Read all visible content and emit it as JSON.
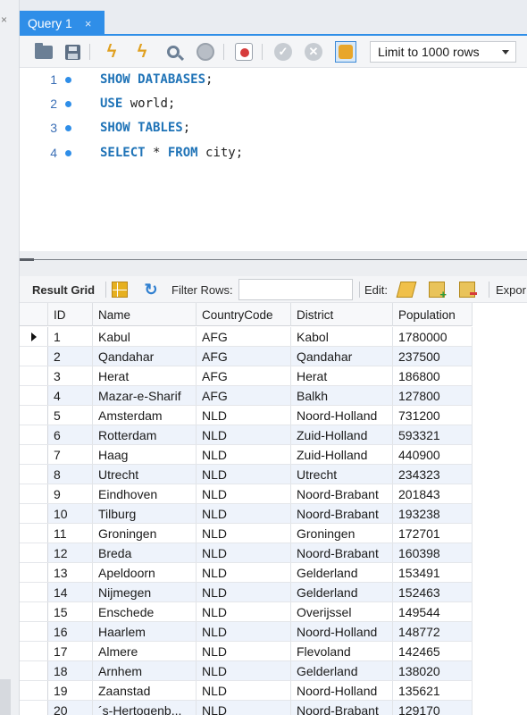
{
  "tabs": [
    {
      "label": "Query 1",
      "close": "×"
    }
  ],
  "left_strip": {
    "close": "×"
  },
  "toolbar": {
    "limit_label": "Limit to 1000 rows",
    "icons": [
      "open-folder-icon",
      "save-icon",
      "execute-icon",
      "execute-current-icon",
      "explain-icon",
      "stop-icon",
      "stop-on-error-icon",
      "commit-icon",
      "rollback-icon",
      "autocommit-icon"
    ]
  },
  "editor": {
    "lines": [
      {
        "num": "1",
        "kw": "SHOW DATABASES",
        "rest": ";"
      },
      {
        "num": "2",
        "kw": "USE",
        "rest": " world;"
      },
      {
        "num": "3",
        "kw": "SHOW TABLES",
        "rest": ";"
      },
      {
        "num": "4",
        "kw": "SELECT",
        "mid": " * ",
        "kw2": "FROM",
        "rest": " city;"
      }
    ]
  },
  "result_toolbar": {
    "result_grid": "Result Grid",
    "filter_rows": "Filter Rows:",
    "filter_value": "",
    "edit": "Edit:",
    "export": "Expor"
  },
  "grid": {
    "columns": [
      "ID",
      "Name",
      "CountryCode",
      "District",
      "Population"
    ],
    "rows": [
      [
        "1",
        "Kabul",
        "AFG",
        "Kabol",
        "1780000"
      ],
      [
        "2",
        "Qandahar",
        "AFG",
        "Qandahar",
        "237500"
      ],
      [
        "3",
        "Herat",
        "AFG",
        "Herat",
        "186800"
      ],
      [
        "4",
        "Mazar-e-Sharif",
        "AFG",
        "Balkh",
        "127800"
      ],
      [
        "5",
        "Amsterdam",
        "NLD",
        "Noord-Holland",
        "731200"
      ],
      [
        "6",
        "Rotterdam",
        "NLD",
        "Zuid-Holland",
        "593321"
      ],
      [
        "7",
        "Haag",
        "NLD",
        "Zuid-Holland",
        "440900"
      ],
      [
        "8",
        "Utrecht",
        "NLD",
        "Utrecht",
        "234323"
      ],
      [
        "9",
        "Eindhoven",
        "NLD",
        "Noord-Brabant",
        "201843"
      ],
      [
        "10",
        "Tilburg",
        "NLD",
        "Noord-Brabant",
        "193238"
      ],
      [
        "11",
        "Groningen",
        "NLD",
        "Groningen",
        "172701"
      ],
      [
        "12",
        "Breda",
        "NLD",
        "Noord-Brabant",
        "160398"
      ],
      [
        "13",
        "Apeldoorn",
        "NLD",
        "Gelderland",
        "153491"
      ],
      [
        "14",
        "Nijmegen",
        "NLD",
        "Gelderland",
        "152463"
      ],
      [
        "15",
        "Enschede",
        "NLD",
        "Overijssel",
        "149544"
      ],
      [
        "16",
        "Haarlem",
        "NLD",
        "Noord-Holland",
        "148772"
      ],
      [
        "17",
        "Almere",
        "NLD",
        "Flevoland",
        "142465"
      ],
      [
        "18",
        "Arnhem",
        "NLD",
        "Gelderland",
        "138020"
      ],
      [
        "19",
        "Zaanstad",
        "NLD",
        "Noord-Holland",
        "135621"
      ],
      [
        "20",
        "´s-Hertogenb...",
        "NLD",
        "Noord-Brabant",
        "129170"
      ]
    ]
  }
}
